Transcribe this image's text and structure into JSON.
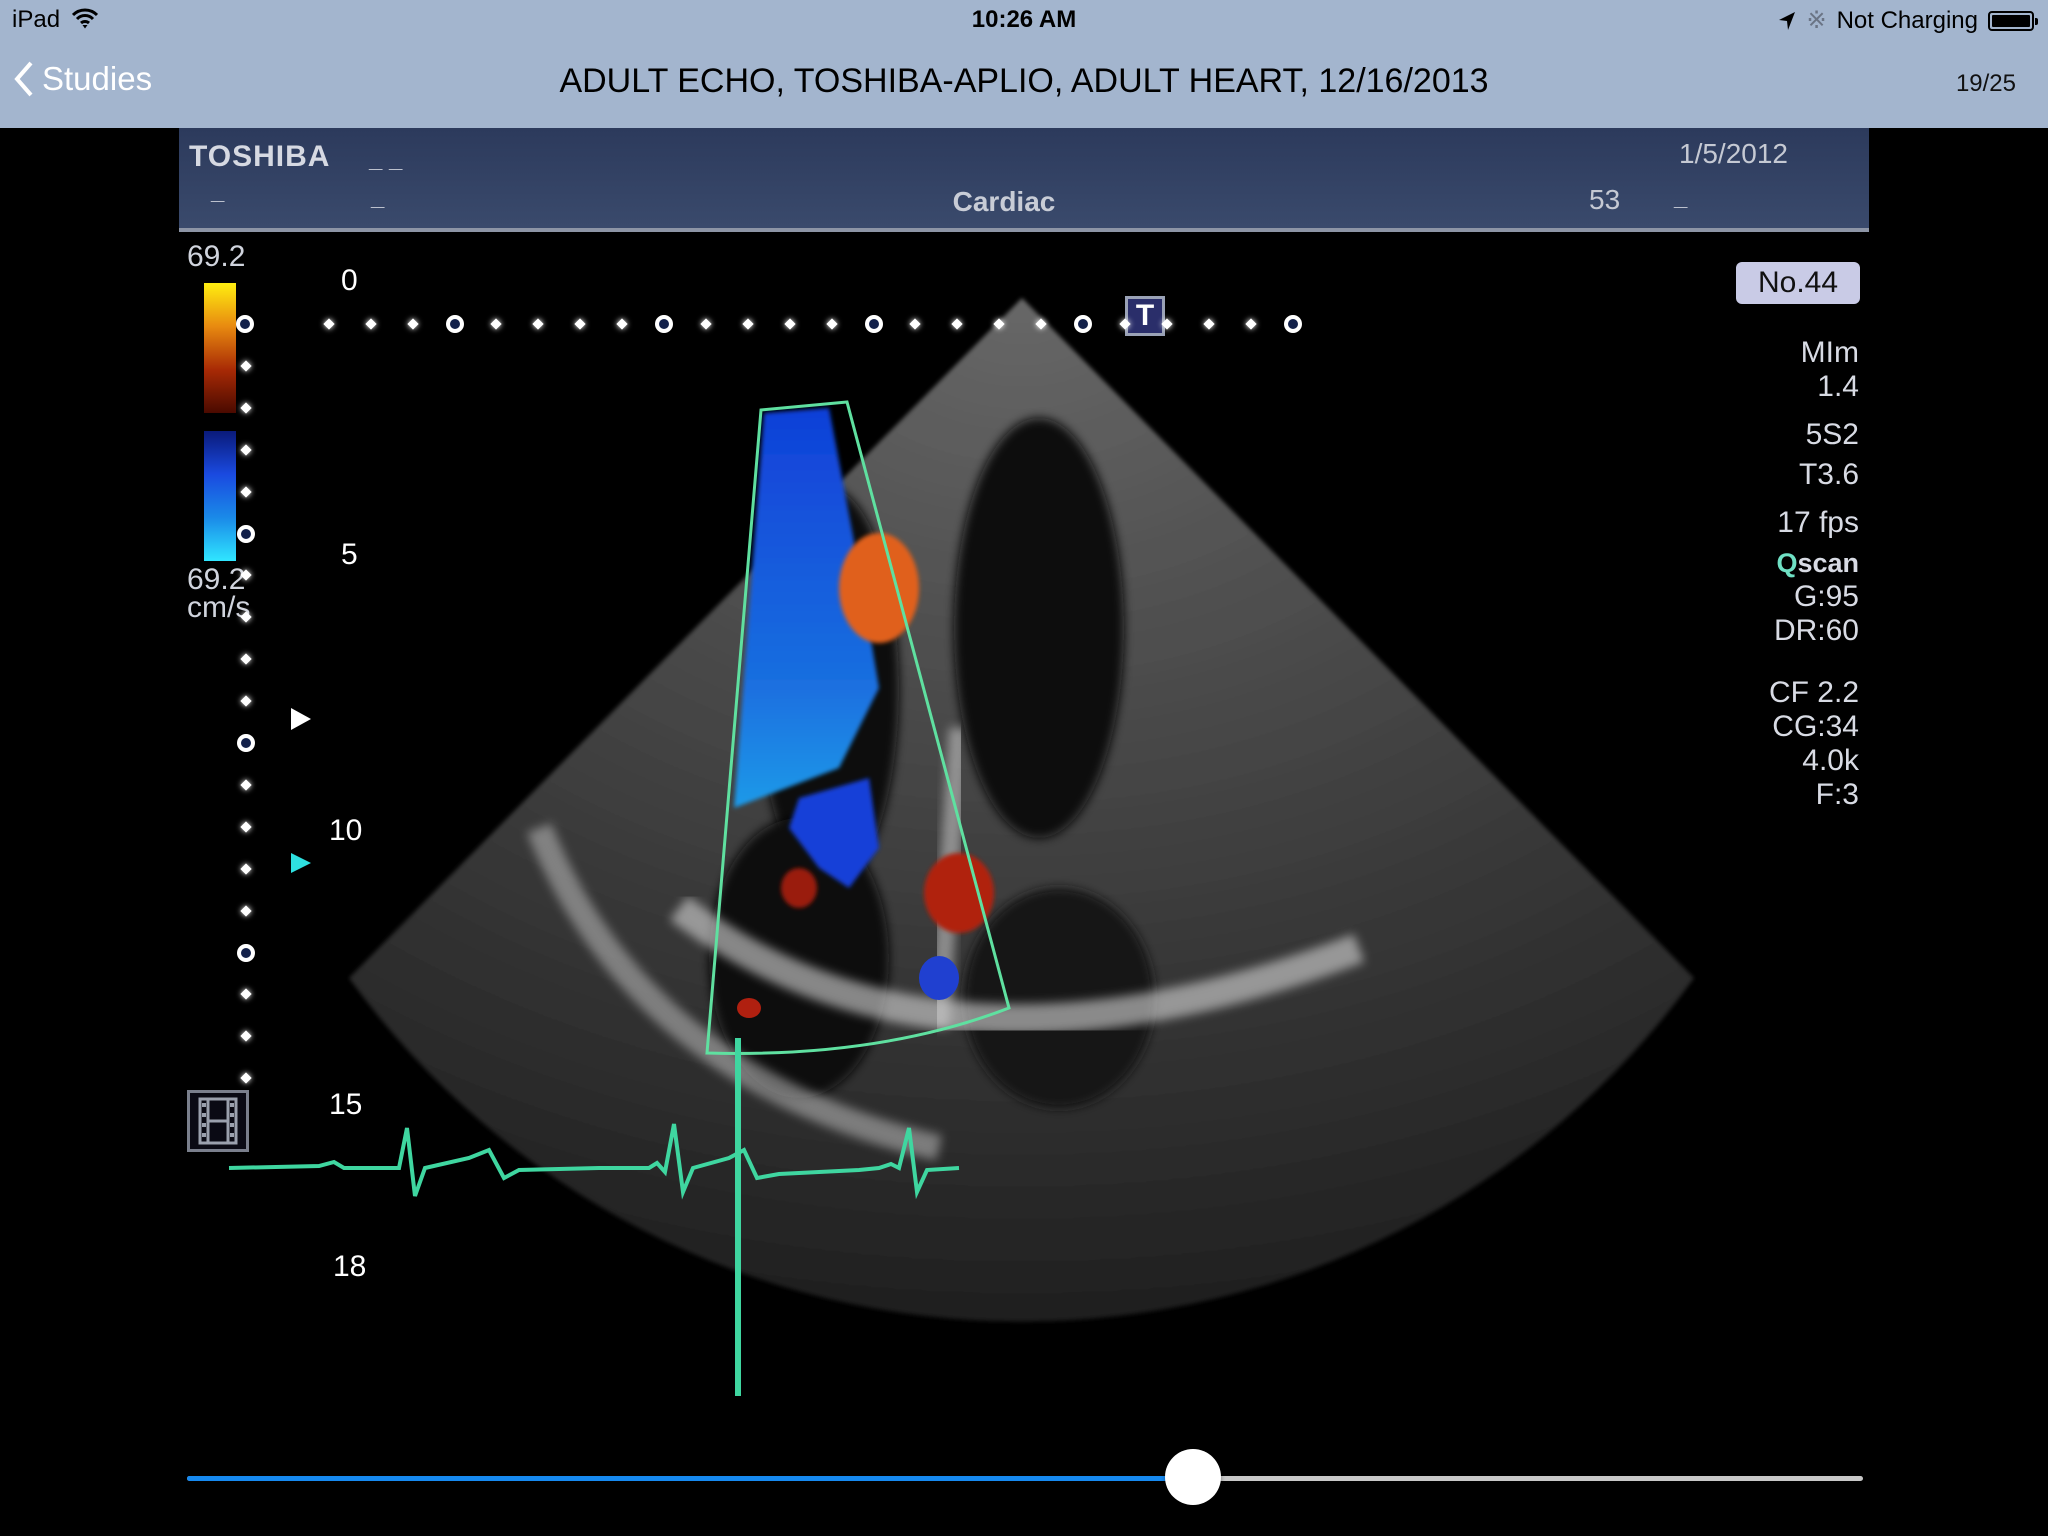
{
  "status_bar": {
    "carrier": "iPad",
    "time": "10:26 AM",
    "battery_text": "Not Charging",
    "icons": [
      "wifi-icon",
      "location-arrow-icon",
      "bluetooth-icon",
      "battery-icon"
    ]
  },
  "nav": {
    "back_label": "Studies",
    "title": "ADULT ECHO, TOSHIBA-APLIO, ADULT HEART, 12/16/2013",
    "counter": "19/25"
  },
  "scan": {
    "header": {
      "brand": "TOSHIBA",
      "mode": "Cardiac",
      "date": "1/5/2012",
      "number": "53",
      "dashes": [
        "_ _",
        "_",
        "_",
        "_"
      ]
    },
    "colorbar": {
      "top_value": "69.2",
      "bottom_value": "69.2",
      "unit": "cm/s",
      "warm_colors": [
        "#ffee10",
        "#e88a10",
        "#a82a05"
      ],
      "cool_colors": [
        "#0a1a7a",
        "#1a4ae0",
        "#30e6ff"
      ]
    },
    "depth_labels": [
      "0",
      "5",
      "10",
      "15",
      "18"
    ],
    "frame_number": "No.44",
    "t_marker": "T",
    "parameters": {
      "group1": [
        "MIm",
        "1.4"
      ],
      "probe": "5S2",
      "t_index": "T3.6",
      "fps": "17 fps",
      "qscan_q": "Q",
      "qscan_rest": "scan",
      "gain": "G:95",
      "dynamic_range": "DR:60",
      "color": [
        "CF 2.2",
        "CG:34",
        "4.0k",
        "F:3"
      ]
    },
    "ecg_color": "#3fd6a0",
    "roi_color": "#5fe0a0"
  },
  "playback": {
    "progress": 0.6,
    "fill_color": "#1689f0"
  }
}
